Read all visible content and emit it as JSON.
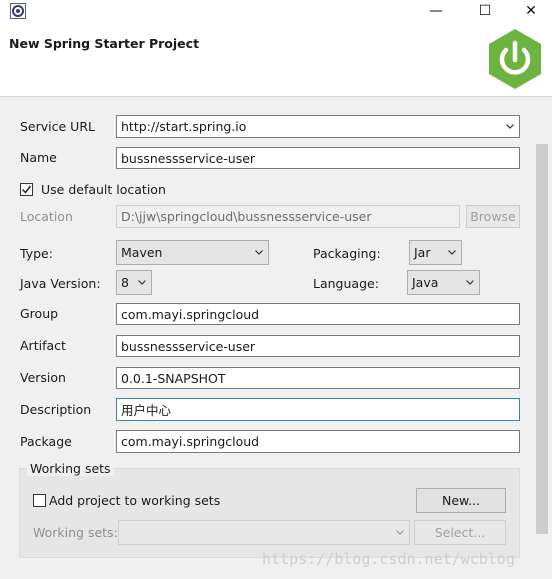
{
  "window": {
    "title": "New Spring Starter Project",
    "controls": {
      "minimize": "—",
      "maximize": "☐",
      "close": "✕"
    }
  },
  "form": {
    "service_url": {
      "label": "Service URL",
      "value": "http://start.spring.io"
    },
    "name": {
      "label": "Name",
      "value": "bussnessservice-user"
    },
    "use_default_location": {
      "label": "Use default location",
      "checked": true
    },
    "location": {
      "label": "Location",
      "value": "D:\\jjw\\springcloud\\bussnessservice-user",
      "browse": "Browse"
    },
    "type": {
      "label": "Type:",
      "value": "Maven"
    },
    "packaging": {
      "label": "Packaging:",
      "value": "Jar"
    },
    "java_version": {
      "label": "Java Version:",
      "value": "8"
    },
    "language": {
      "label": "Language:",
      "value": "Java"
    },
    "group": {
      "label": "Group",
      "value": "com.mayi.springcloud"
    },
    "artifact": {
      "label": "Artifact",
      "value": "bussnessservice-user"
    },
    "version": {
      "label": "Version",
      "value": "0.0.1-SNAPSHOT"
    },
    "description": {
      "label": "Description",
      "value": "用户中心"
    },
    "package": {
      "label": "Package",
      "value": "com.mayi.springcloud"
    }
  },
  "working_sets": {
    "title": "Working sets",
    "add_label": "Add project to working sets",
    "add_checked": false,
    "new_button": "New...",
    "sets_label": "Working sets:",
    "sets_value": "",
    "select_button": "Select..."
  },
  "watermark": "https://blog.csdn.net/wcblog",
  "colors": {
    "spring_green": "#6db33f",
    "focus_border": "#3c7fb1"
  }
}
